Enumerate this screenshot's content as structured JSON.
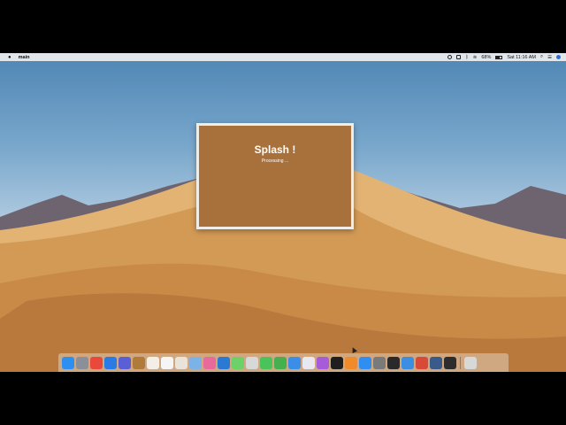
{
  "menubar": {
    "apple_icon": "apple-icon",
    "app_name": "main",
    "status_icons": [
      "screen-record-icon",
      "display-icon",
      "bluetooth-icon",
      "wifi-icon"
    ],
    "battery_percent": "68%",
    "datetime": "Sat 11:16 AM",
    "trailing_icons": [
      "search-icon",
      "user-list-icon",
      "siri-icon"
    ]
  },
  "splash": {
    "title": "Splash !",
    "status": "Processing ..."
  },
  "dock": {
    "apps": [
      {
        "name": "finder",
        "color": "#2d8ff0"
      },
      {
        "name": "launchpad",
        "color": "#8a8f9a"
      },
      {
        "name": "chrome",
        "color": "#e9493a"
      },
      {
        "name": "safari",
        "color": "#2b7be4"
      },
      {
        "name": "mail",
        "color": "#5b5fd6"
      },
      {
        "name": "notes-app",
        "color": "#b07a3a"
      },
      {
        "name": "text-editor",
        "color": "#f4efe4"
      },
      {
        "name": "calendar",
        "color": "#f5f5f5"
      },
      {
        "name": "contacts",
        "color": "#e9e3d8"
      },
      {
        "name": "preview",
        "color": "#7bb3e8"
      },
      {
        "name": "photos",
        "color": "#e86a9a"
      },
      {
        "name": "vscode",
        "color": "#2a7ad3"
      },
      {
        "name": "messages-app",
        "color": "#6dd16a"
      },
      {
        "name": "script-editor",
        "color": "#d8d8d8"
      },
      {
        "name": "facetime",
        "color": "#4cc25a"
      },
      {
        "name": "numbers",
        "color": "#46b04f"
      },
      {
        "name": "keynote",
        "color": "#3a8ee8"
      },
      {
        "name": "itunes",
        "color": "#e8e8f0"
      },
      {
        "name": "podcasts",
        "color": "#a65bd8"
      },
      {
        "name": "apple-tv",
        "color": "#1f1f1f"
      },
      {
        "name": "books",
        "color": "#f08a2a"
      },
      {
        "name": "app-store",
        "color": "#2f8ef0"
      },
      {
        "name": "system-preferences",
        "color": "#7a7a7a"
      },
      {
        "name": "terminal",
        "color": "#2a2a2a"
      },
      {
        "name": "xcode",
        "color": "#3b8ee0"
      },
      {
        "name": "instruments",
        "color": "#d9493a"
      },
      {
        "name": "quicktime",
        "color": "#3a5a8a"
      },
      {
        "name": "console",
        "color": "#2d2d2d"
      },
      {
        "name": "trash",
        "color": "#d8d8d8"
      }
    ]
  }
}
